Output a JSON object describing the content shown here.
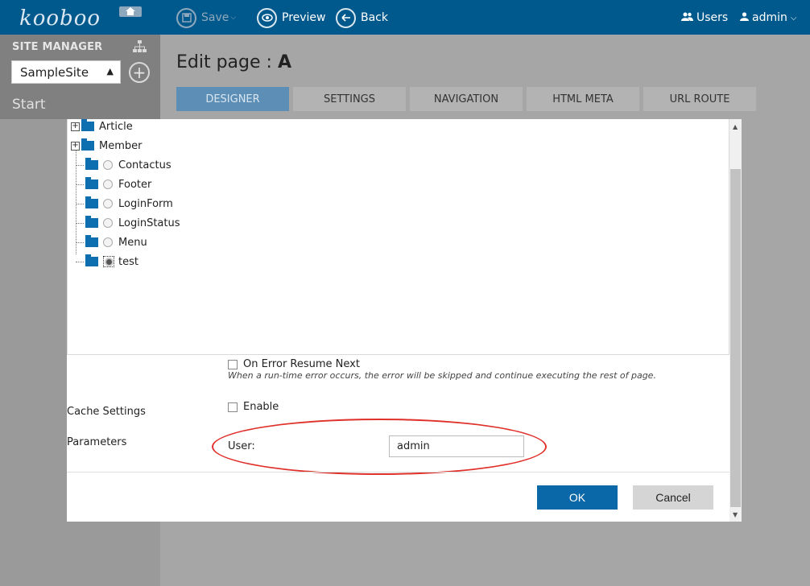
{
  "topbar": {
    "logo": "kooboo",
    "save_label": "Save",
    "preview_label": "Preview",
    "back_label": "Back",
    "users_label": "Users",
    "admin_label": "admin"
  },
  "sidebar": {
    "title": "SITE MANAGER",
    "site_selected": "SampleSite",
    "start_label": "Start"
  },
  "header": {
    "title_prefix": "Edit page : ",
    "title_name": "A",
    "tabs": [
      {
        "label": "DESIGNER",
        "active": true
      },
      {
        "label": "SETTINGS",
        "active": false
      },
      {
        "label": "NAVIGATION",
        "active": false
      },
      {
        "label": "HTML META",
        "active": false
      },
      {
        "label": "URL ROUTE",
        "active": false
      }
    ]
  },
  "tree": {
    "folders": [
      {
        "label": "Article"
      },
      {
        "label": "Member"
      }
    ],
    "items": [
      {
        "label": "Contactus",
        "selected": false
      },
      {
        "label": "Footer",
        "selected": false
      },
      {
        "label": "LoginForm",
        "selected": false
      },
      {
        "label": "LoginStatus",
        "selected": false
      },
      {
        "label": "Menu",
        "selected": false
      },
      {
        "label": "test",
        "selected": true
      }
    ]
  },
  "form": {
    "error_option_label": "On Error Resume Next",
    "error_hint": "When a run-time error occurs, the error will be skipped and continue executing the rest of page.",
    "cache_label": "Cache Settings",
    "cache_enable_label": "Enable",
    "parameters_label": "Parameters",
    "user_label": "User:",
    "user_value": "admin"
  },
  "buttons": {
    "ok": "OK",
    "cancel": "Cancel"
  },
  "colors": {
    "topbar": "#00598d",
    "accent": "#0a67a8",
    "annotation": "#e0302a"
  }
}
